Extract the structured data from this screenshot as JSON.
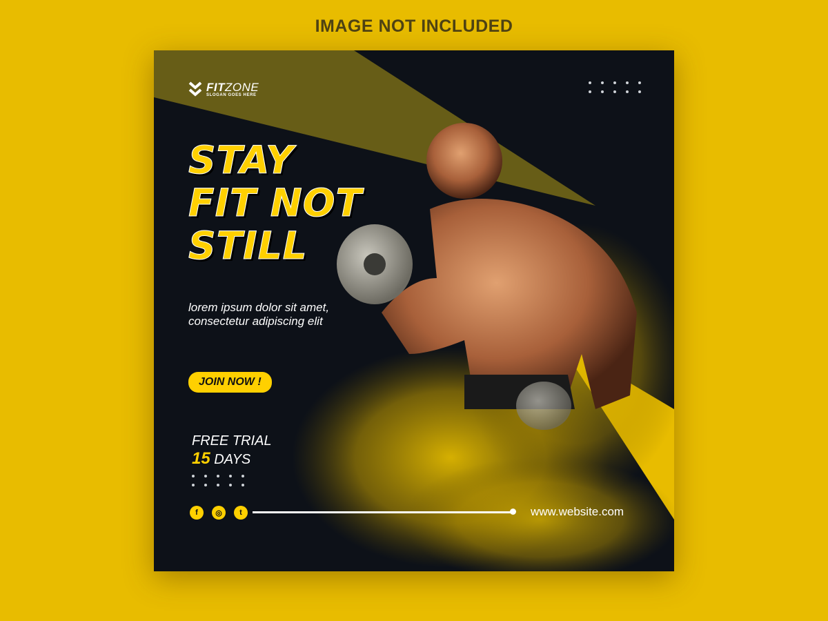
{
  "note": "IMAGE NOT INCLUDED",
  "brand": {
    "name_bold": "FIT",
    "name_rest": "ZONE",
    "slogan": "SLOGAN GOES HERE"
  },
  "headline": [
    "STAY",
    "FIT NOT",
    "STILL"
  ],
  "subtitle": [
    "lorem ipsum dolor sit amet,",
    "consectetur adipiscing elit"
  ],
  "cta": "JOIN NOW !",
  "trial": {
    "line1": "FREE TRIAL",
    "number": "15",
    "unit": "DAYS"
  },
  "social": [
    {
      "icon": "facebook-icon",
      "glyph": "f"
    },
    {
      "icon": "instagram-icon",
      "glyph": "◎"
    },
    {
      "icon": "twitter-icon",
      "glyph": "t"
    }
  ],
  "website": "www.website.com",
  "colors": {
    "page_bg": "#e8bc00",
    "post_bg": "#0d1118",
    "accent": "#ffd000",
    "olive": "#6f6418"
  }
}
